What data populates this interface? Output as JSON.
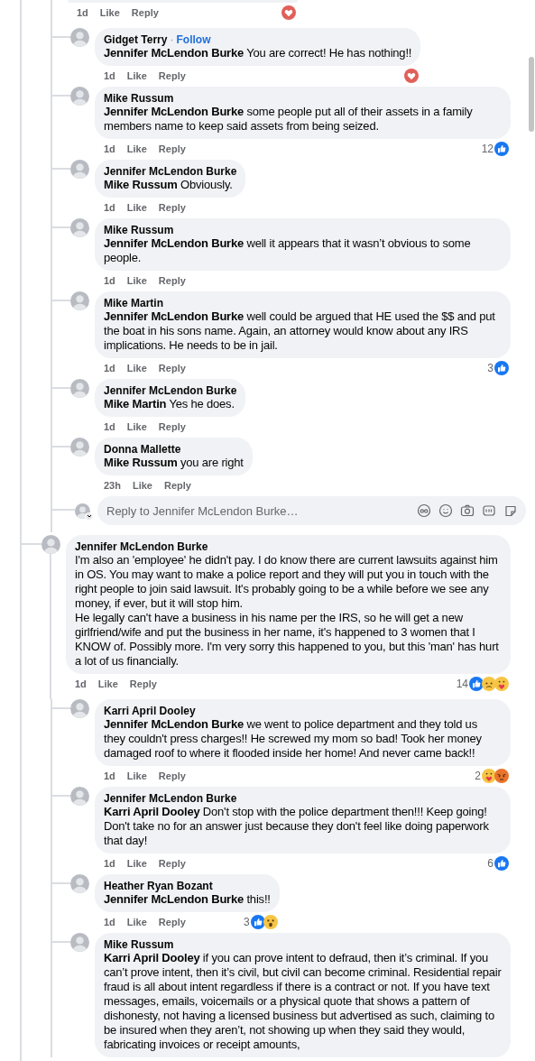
{
  "threads": [
    {
      "comment": {
        "time": "1d",
        "actions": [
          "Like",
          "Reply"
        ],
        "reactions": {
          "icons": [
            {
              "kind": "love"
            }
          ]
        }
      },
      "replies": [
        {
          "author": "Gidget Terry",
          "follow_separator": "·",
          "follow": "Follow",
          "text": "**Jennifer McLendon Burke** You are correct! He has nothing!!",
          "time": "1d",
          "actions": [
            "Like",
            "Reply"
          ],
          "reactions": {
            "icons": [
              {
                "kind": "love"
              }
            ]
          }
        },
        {
          "author": "Mike Russum",
          "text": "**Jennifer McLendon Burke** some people put all of their assets in a family members name to keep said assets from being seized.",
          "time": "1d",
          "actions": [
            "Like",
            "Reply"
          ],
          "reactions": {
            "count": "12",
            "icons": [
              {
                "kind": "like"
              }
            ]
          }
        },
        {
          "author": "Jennifer McLendon Burke",
          "text": "**Mike Russum** Obviously.",
          "time": "1d",
          "actions": [
            "Like",
            "Reply"
          ]
        },
        {
          "author": "Mike Russum",
          "text": "**Jennifer McLendon Burke** well it appears that it wasn’t obvious to some people.",
          "time": "1d",
          "actions": [
            "Like",
            "Reply"
          ]
        },
        {
          "author": "Mike Martin",
          "text": "**Jennifer McLendon Burke** well could be argued that HE used the $$ and put the boat in his sons name. Again, an attorney would know about any IRS implications. He needs to be in jail.",
          "time": "1d",
          "actions": [
            "Like",
            "Reply"
          ],
          "reactions": {
            "count": "3",
            "icons": [
              {
                "kind": "like"
              }
            ]
          }
        },
        {
          "author": "Jennifer McLendon Burke",
          "text": "**Mike Martin** Yes he does.",
          "time": "1d",
          "actions": [
            "Like",
            "Reply"
          ]
        },
        {
          "author": "Donna Mallette",
          "text": "**Mike Russum** you are right",
          "time": "23h",
          "actions": [
            "Like",
            "Reply"
          ]
        }
      ],
      "reply_box": {
        "placeholder": "Reply to Jennifer McLendon Burke…"
      }
    },
    {
      "comment": {
        "author": "Jennifer McLendon Burke",
        "text": "I'm also an 'employee' he didn't pay. I do know there are current lawsuits against him in OS. You may want to make a police report and they will put you in touch with the right people to join said lawsuit. It's probably going to be a while before we see any money, if ever, but it will stop him.\nHe legally can't have a business in his name per the IRS, so he will get a new girlfriend/wife and put the business in her name, it's happened to 3 women that I KNOW of. Possibly more. I'm very sorry this happened to you, but this 'man' has hurt a lot of us financially.",
        "time": "1d",
        "actions": [
          "Like",
          "Reply"
        ],
        "reactions": {
          "count": "14",
          "icons": [
            {
              "kind": "like"
            },
            {
              "kind": "sad"
            },
            {
              "kind": "care"
            }
          ]
        }
      },
      "replies": [
        {
          "author": "Karri April Dooley",
          "text": "**Jennifer McLendon Burke** we went to police department and they told us they couldn't press charges!! He screwed my mom so bad! Took her money damaged roof to where it flooded inside her home! And never came back!!",
          "time": "1d",
          "actions": [
            "Like",
            "Reply"
          ],
          "reactions": {
            "count": "2",
            "icons": [
              {
                "kind": "care"
              },
              {
                "kind": "angry"
              }
            ]
          }
        },
        {
          "author": "Jennifer McLendon Burke",
          "text": "**Karri April Dooley** Don't stop with the police department then!!! Keep going! Don't take no for an answer just because they don't feel like doing paperwork that day!",
          "time": "1d",
          "actions": [
            "Like",
            "Reply"
          ],
          "reactions": {
            "count": "6",
            "icons": [
              {
                "kind": "like"
              }
            ]
          }
        },
        {
          "author": "Heather Ryan Bozant",
          "text": "**Jennifer McLendon Burke** this!!",
          "time": "1d",
          "actions": [
            "Like",
            "Reply"
          ],
          "reactions": {
            "count": "3",
            "icons": [
              {
                "kind": "like"
              },
              {
                "kind": "wow"
              }
            ]
          }
        },
        {
          "author": "Mike Russum",
          "text": "**Karri April Dooley** if you can prove intent to defraud, then it’s criminal. If you can’t prove intent, then it’s civil, but civil can become criminal. Residential repair fraud is all about intent regardless if there is a contract or not. If you have text messages, emails, voicemails or a physical quote that shows a pattern of dishonesty, not having a licensed business but advertised as such, claiming to be insured when they aren’t, not showing up when they said they would, fabricating invoices or receipt amounts,"
        }
      ]
    }
  ]
}
